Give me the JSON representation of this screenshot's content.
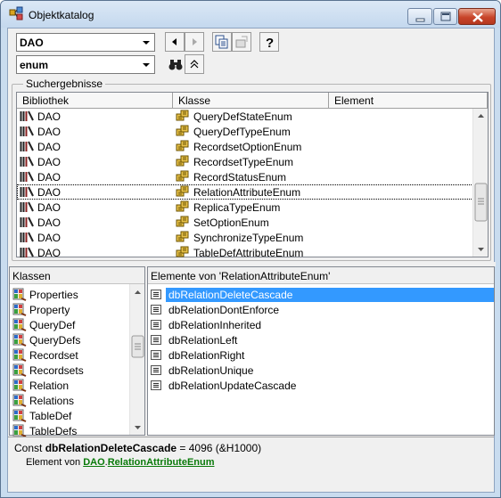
{
  "window": {
    "title": "Objektkatalog"
  },
  "toolbar": {
    "library_value": "DAO",
    "search_value": "enum"
  },
  "results": {
    "legend": "Suchergebnisse",
    "columns": [
      "Bibliothek",
      "Klasse",
      "Element"
    ],
    "rows": [
      {
        "library": "DAO",
        "class": "QueryDefStateEnum"
      },
      {
        "library": "DAO",
        "class": "QueryDefTypeEnum"
      },
      {
        "library": "DAO",
        "class": "RecordsetOptionEnum"
      },
      {
        "library": "DAO",
        "class": "RecordsetTypeEnum"
      },
      {
        "library": "DAO",
        "class": "RecordStatusEnum"
      },
      {
        "library": "DAO",
        "class": "RelationAttributeEnum"
      },
      {
        "library": "DAO",
        "class": "ReplicaTypeEnum"
      },
      {
        "library": "DAO",
        "class": "SetOptionEnum"
      },
      {
        "library": "DAO",
        "class": "SynchronizeTypeEnum"
      },
      {
        "library": "DAO",
        "class": "TableDefAttributeEnum"
      }
    ]
  },
  "classes": {
    "header": "Klassen",
    "items": [
      "Properties",
      "Property",
      "QueryDef",
      "QueryDefs",
      "Recordset",
      "Recordsets",
      "Relation",
      "Relations",
      "TableDef",
      "TableDefs"
    ]
  },
  "members": {
    "header": "Elemente von 'RelationAttributeEnum'",
    "items": [
      "dbRelationDeleteCascade",
      "dbRelationDontEnforce",
      "dbRelationInherited",
      "dbRelationLeft",
      "dbRelationRight",
      "dbRelationUnique",
      "dbRelationUpdateCascade"
    ]
  },
  "details": {
    "prefix": "Const ",
    "name": "dbRelationDeleteCascade",
    "value": " = 4096 (&H1000)",
    "member_of_label": "Element von ",
    "library_link": "DAO",
    "separator": ".",
    "class_link": "RelationAttributeEnum"
  },
  "colors": {
    "selection": "#3399ff",
    "link": "#0a7a0a",
    "window_frame": "#c9dcef"
  },
  "icons": [
    "object-catalog-icon",
    "minimize-icon",
    "maximize-icon",
    "close-icon",
    "dropdown-arrow-icon",
    "back-icon",
    "forward-icon",
    "copy-icon",
    "view-definition-icon",
    "help-icon",
    "binoculars-icon",
    "collapse-icon",
    "library-icon",
    "enum-icon",
    "class-icon",
    "constant-icon"
  ]
}
